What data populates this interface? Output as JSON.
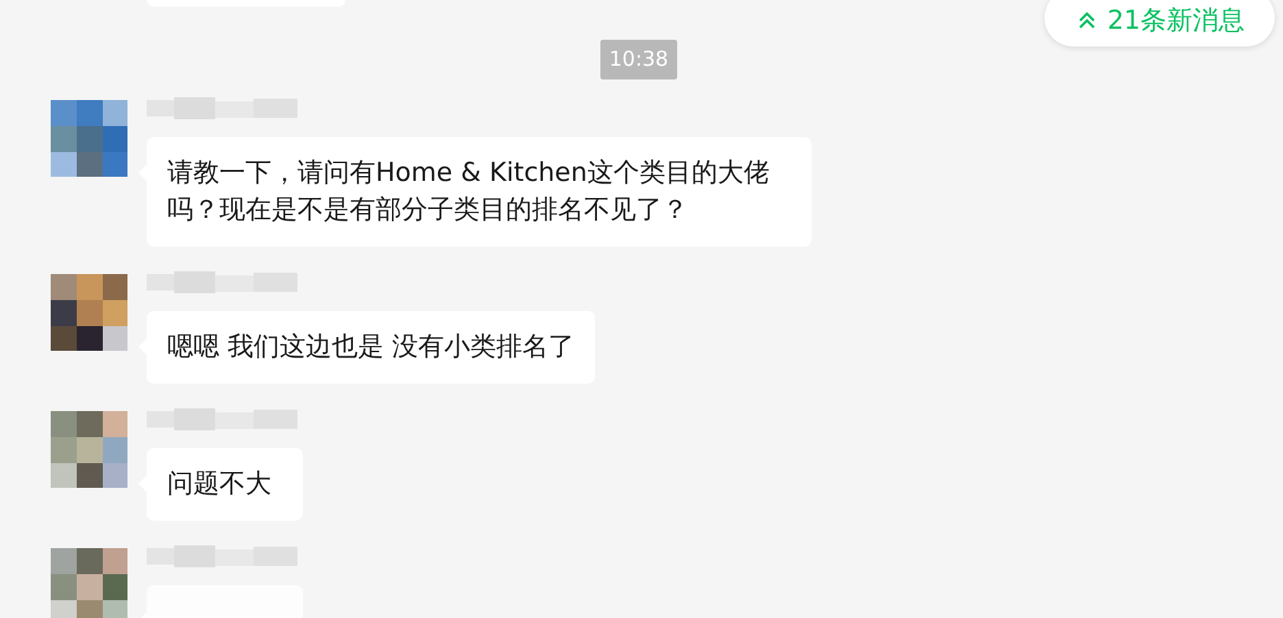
{
  "new_messages_badge": {
    "label": "21条新消息"
  },
  "timestamp": "10:38",
  "messages": [
    {
      "text": "请教一下，请问有Home & Kitchen这个类目的大佬吗？现在是不是有部分子类目的排名不见了？"
    },
    {
      "text": "嗯嗯 我们这边也是 没有小类排名了"
    },
    {
      "text": "问题不大"
    }
  ],
  "more_below": true
}
